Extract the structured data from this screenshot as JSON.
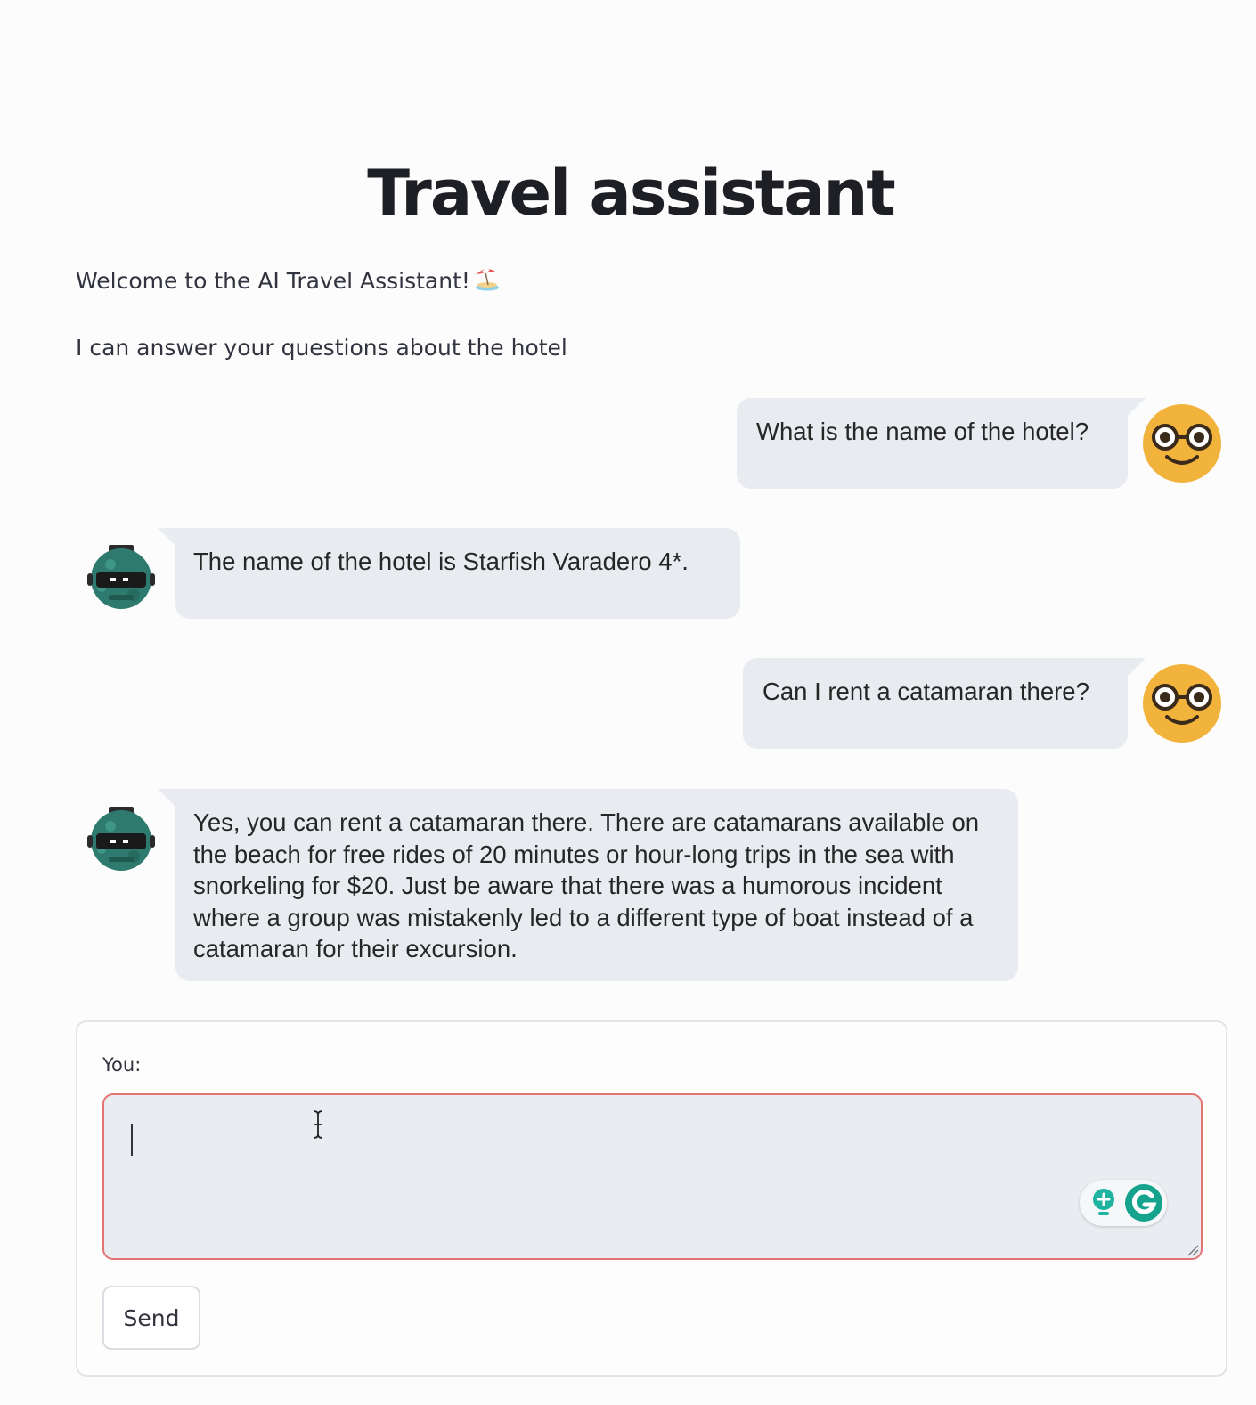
{
  "header": {
    "title": "Travel assistant"
  },
  "intro": {
    "welcome": "Welcome to the AI Travel Assistant!",
    "welcome_emoji": "beach-umbrella-icon",
    "subtitle": "I can answer your questions about the hotel"
  },
  "chat": {
    "messages": [
      {
        "role": "user",
        "text": "What is the name of the hotel?"
      },
      {
        "role": "assistant",
        "text": "The name of the hotel is Starfish Varadero 4*."
      },
      {
        "role": "user",
        "text": "Can I rent a catamaran there?"
      },
      {
        "role": "assistant",
        "text": "Yes, you can rent a catamaran there. There are catamarans available on the beach for free rides of 20 minutes or hour-long trips in the sea with snorkeling for $20. Just be aware that there was a humorous incident where a group was mistakenly led to a different type of boat instead of a catamaran for their excursion."
      }
    ],
    "user_avatar": "nerd-face-icon",
    "assistant_avatar": "robot-icon"
  },
  "input_form": {
    "label": "You:",
    "value": "",
    "send_label": "Send",
    "extension_icons": [
      "lightbulb-icon",
      "grammarly-icon"
    ]
  },
  "colors": {
    "bubble_background": "#e8ebef",
    "input_border": "#e57373",
    "user_avatar_yellow": "#f2b33d",
    "assistant_avatar_teal": "#2f7a6f"
  }
}
